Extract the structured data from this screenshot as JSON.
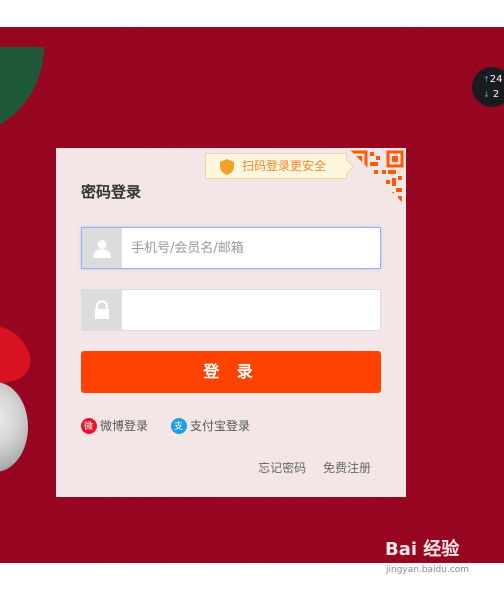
{
  "login": {
    "title": "密码登录",
    "qr_tip": "扫码登录更安全",
    "username_placeholder": "手机号/会员名/邮箱",
    "password_placeholder": "",
    "submit_label": "登 录",
    "weibo_label": "微博登录",
    "alipay_label": "支付宝登录",
    "forgot_password": "忘记密码",
    "register": "免费注册"
  },
  "stock_widget": {
    "up_value": "24",
    "down_value": "2"
  },
  "watermark": {
    "brand": "Bai 经验",
    "url": "jingyan.baidu.com"
  },
  "colors": {
    "background": "#9a0722",
    "accent": "#ff4200",
    "panel": "#f4e6e7",
    "qr": "#ff5a00"
  }
}
